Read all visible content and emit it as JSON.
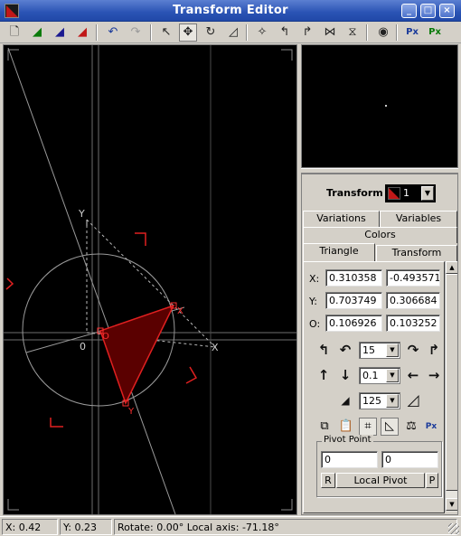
{
  "window": {
    "title": "Transform Editor",
    "controls": [
      "minimize",
      "maximize",
      "close"
    ]
  },
  "toolbar": {
    "buttons": [
      {
        "name": "new-transform",
        "icon": "new-document-icon"
      },
      {
        "name": "add-transform",
        "icon": "add-triangle-icon"
      },
      {
        "name": "duplicate-transform",
        "icon": "duplicate-triangle-icon"
      },
      {
        "name": "delete-transform",
        "icon": "delete-triangle-icon"
      },
      {
        "name": "undo",
        "icon": "undo-icon"
      },
      {
        "name": "redo",
        "icon": "redo-icon"
      },
      {
        "name": "select-mode",
        "icon": "arrow-cursor-icon"
      },
      {
        "name": "move-mode",
        "icon": "move-icon"
      },
      {
        "name": "rotate-mode",
        "icon": "rotate-icon"
      },
      {
        "name": "scale-mode",
        "icon": "scale-icon"
      },
      {
        "name": "reset",
        "icon": "reset-icon"
      },
      {
        "name": "rotate-left",
        "icon": "rotate-left-icon"
      },
      {
        "name": "rotate-right",
        "icon": "rotate-right-icon"
      },
      {
        "name": "flip-horizontal",
        "icon": "flip-horizontal-icon"
      },
      {
        "name": "flip-vertical",
        "icon": "flip-vertical-icon"
      },
      {
        "name": "preview",
        "icon": "eye-icon"
      },
      {
        "name": "post-transform-1",
        "icon": "post-transform-icon"
      },
      {
        "name": "post-transform-2",
        "icon": "post-transform-add-icon"
      }
    ]
  },
  "editor": {
    "axis_labels": {
      "x": "X",
      "y": "Y",
      "origin": "0",
      "other_origin": "O"
    }
  },
  "panel": {
    "transform_label": "Transform",
    "transform_value": "1",
    "tabs_row1": [
      "Variations",
      "Variables"
    ],
    "tabs_row2": [
      "Colors"
    ],
    "tabs_row3": [
      "Triangle",
      "Transform"
    ],
    "active_tab": "Triangle",
    "coords": {
      "x_label": "X:",
      "x1": "0.310358",
      "x2": "-0.493571",
      "y_label": "Y:",
      "y1": "0.703749",
      "y2": "0.306684",
      "o_label": "O:",
      "o1": "0.106926",
      "o2": "0.103252"
    },
    "rotate_step": "15",
    "move_step": "0.1",
    "scale_step": "125",
    "pivot": {
      "title": "Pivot Point",
      "x": "0",
      "y": "0",
      "reset_label": "R",
      "mode_label": "Local Pivot",
      "pick_label": "P"
    }
  },
  "status": {
    "x": "X: 0.42",
    "y": "Y: 0.23",
    "info": "Rotate: 0.00°  Local axis: -71.18°"
  },
  "colors": {
    "triangle": "#c01818",
    "titlebar": "#2a53b4"
  }
}
